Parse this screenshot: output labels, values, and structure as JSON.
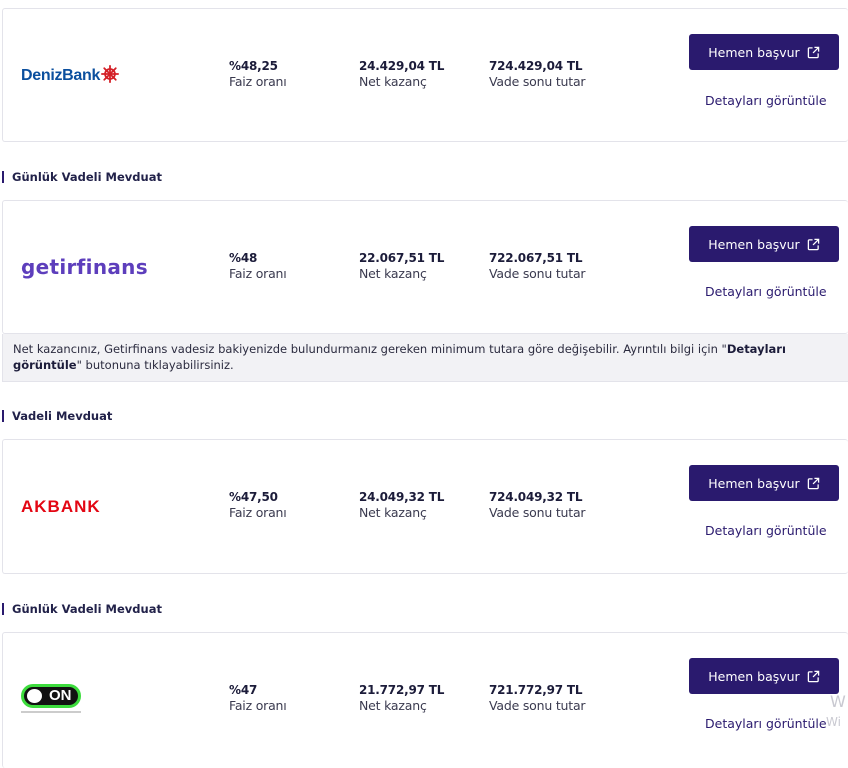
{
  "offers": [
    {
      "bank": "DenizBank",
      "rate": "%48,25",
      "rate_label": "Faiz oranı",
      "net": "24.429,04 TL",
      "net_label": "Net kazanç",
      "total": "724.429,04 TL",
      "total_label": "Vade sonu tutar",
      "apply_label": "Hemen başvur",
      "details_label": "Detayları görüntüle"
    },
    {
      "section": "Günlük Vadeli Mevduat",
      "bank": "getirfinans",
      "rate": "%48",
      "rate_label": "Faiz oranı",
      "net": "22.067,51 TL",
      "net_label": "Net kazanç",
      "total": "722.067,51 TL",
      "total_label": "Vade sonu tutar",
      "apply_label": "Hemen başvur",
      "details_label": "Detayları görüntüle",
      "note_pre": "Net kazancınız, Getirfinans vadesiz bakiyenizde bulundurmanız gereken minimum tutara göre değişebilir. Ayrıntılı bilgi için \"",
      "note_bold": "Detayları görüntüle",
      "note_post": "\" butonuna tıklayabilirsiniz."
    },
    {
      "section": "Vadeli Mevduat",
      "bank": "AKBANK",
      "rate": "%47,50",
      "rate_label": "Faiz oranı",
      "net": "24.049,32 TL",
      "net_label": "Net kazanç",
      "total": "724.049,32 TL",
      "total_label": "Vade sonu tutar",
      "apply_label": "Hemen başvur",
      "details_label": "Detayları görüntüle"
    },
    {
      "section": "Günlük Vadeli Mevduat",
      "bank": "ON",
      "rate": "%47",
      "rate_label": "Faiz oranı",
      "net": "21.772,97 TL",
      "net_label": "Net kazanç",
      "total": "721.772,97 TL",
      "total_label": "Vade sonu tutar",
      "apply_label": "Hemen başvur",
      "details_label": "Detayları görüntüle"
    }
  ],
  "watermark": {
    "line1": "W",
    "line2": "Wi"
  },
  "colors": {
    "accent": "#2a1a6e",
    "denizbank": "#0b4f9e",
    "denizbank_mark": "#d42027",
    "getir": "#5d3ebc",
    "akbank": "#e30613",
    "on_green": "#3ddc3d"
  },
  "icons": {
    "apply": "external-link-icon"
  }
}
